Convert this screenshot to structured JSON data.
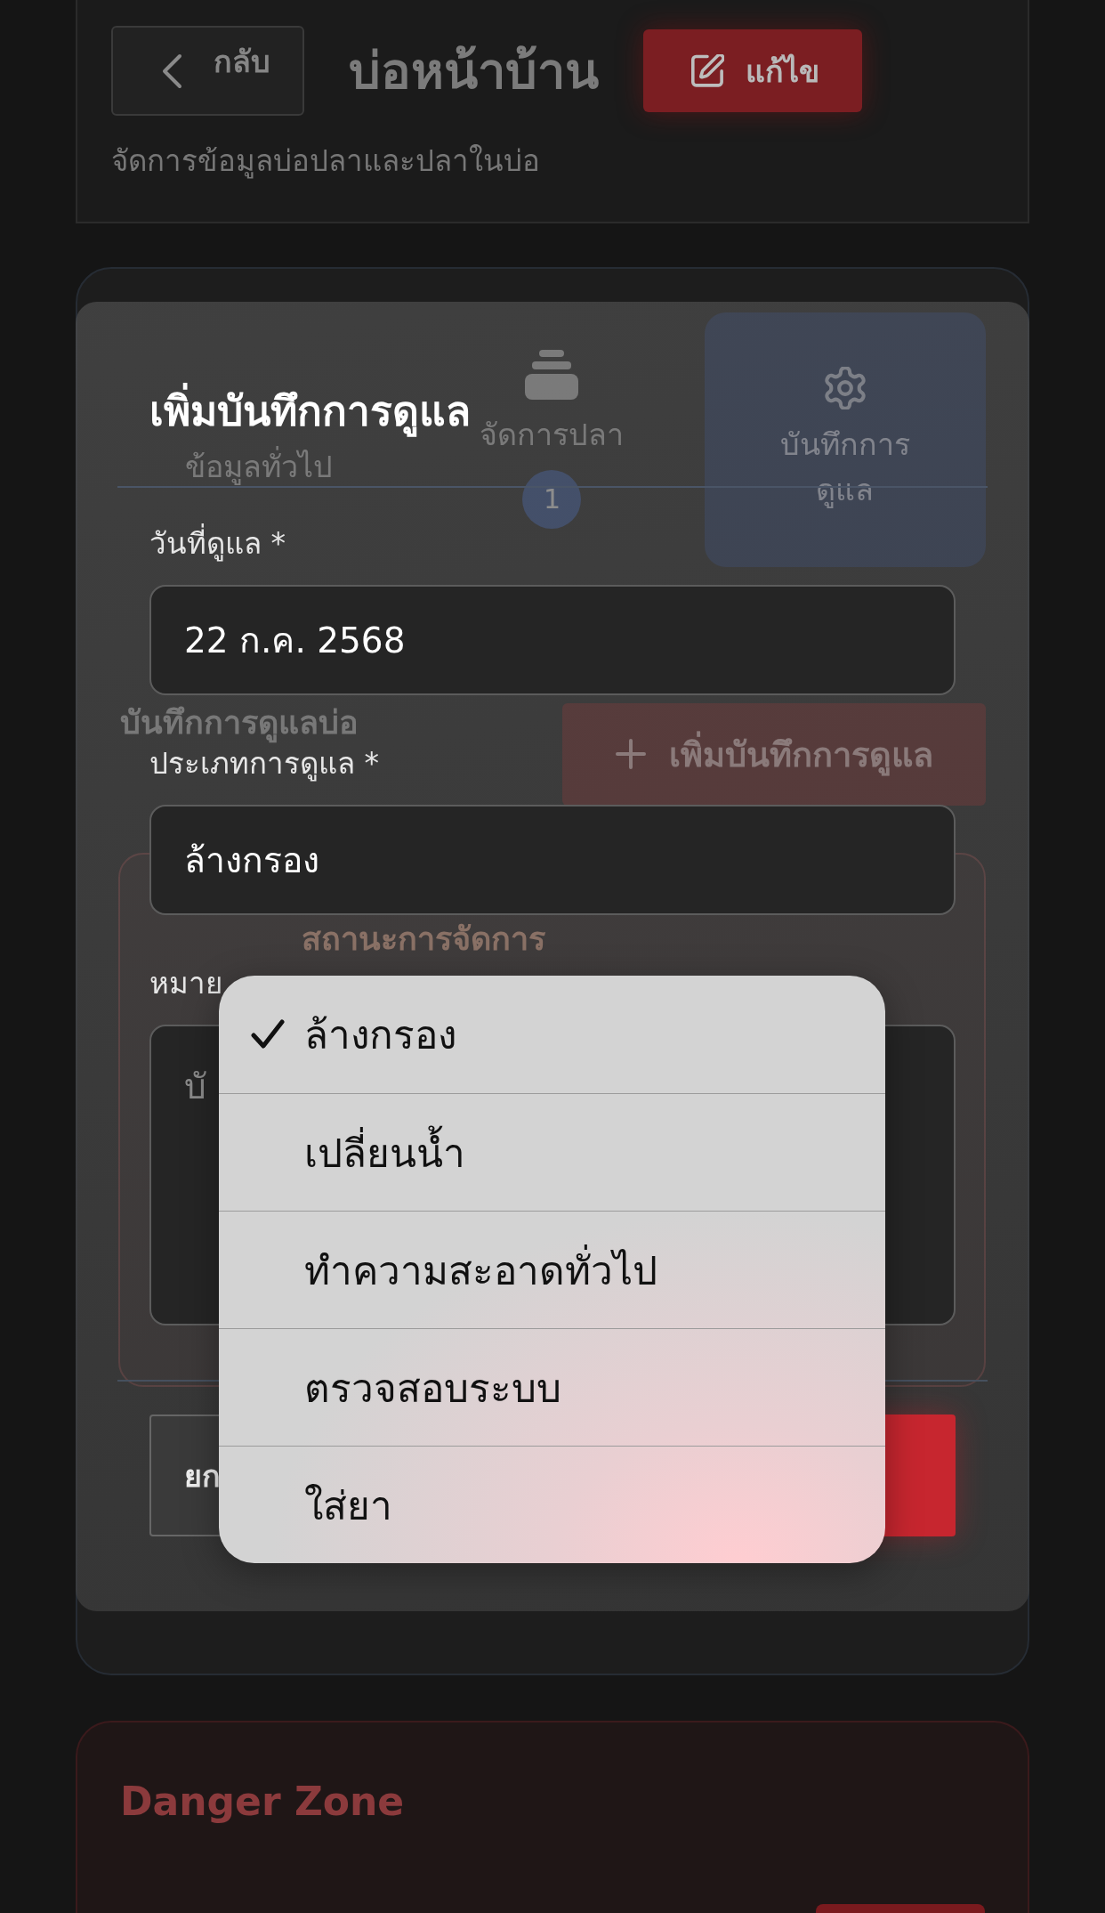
{
  "header": {
    "back_button": {
      "label": "กลับ"
    },
    "title": "บ่อหน้าบ้าน",
    "edit_button": {
      "label": "แก้ไข"
    },
    "subtitle": "จัดการข้อมูลบ่อปลาและปลาในบ่อ"
  },
  "tabs": [
    {
      "label": "ข้อมูลทั่วไป",
      "selected": false
    },
    {
      "label": "จัดการปลา",
      "selected": false,
      "badge": "1"
    },
    {
      "label": "บันทึกการดูแล",
      "selected": true
    }
  ],
  "care_section": {
    "title": "บันทึกการดูแลบ่อ",
    "add_button": {
      "label": "เพิ่มบันทึกการดูแล"
    }
  },
  "status_card": {
    "title": "สถานะการจัดการ"
  },
  "modal": {
    "title": "เพิ่มบันทึกการดูแล",
    "fields": [
      {
        "kind": "date",
        "label": "วันที่ดูแล *",
        "value": "22 ก.ค. 2568"
      },
      {
        "kind": "select",
        "label": "ประเภทการดูแล *",
        "value": "ล้างกรอง"
      },
      {
        "kind": "textarea",
        "label": "หมาย",
        "placeholder": "บั"
      }
    ],
    "buttons": [
      {
        "kind": "secondary",
        "label": "ยก"
      },
      {
        "kind": "primary"
      }
    ]
  },
  "picker": {
    "options": [
      {
        "label": "ล้างกรอง",
        "selected": true
      },
      {
        "label": "เปลี่ยนน้ำ",
        "selected": false
      },
      {
        "label": "ทำความสะอาดทั่วไป",
        "selected": false
      },
      {
        "label": "ตรวจสอบระบบ",
        "selected": false
      },
      {
        "label": "ใส่ยา",
        "selected": false
      }
    ]
  },
  "danger_zone": {
    "title": "Danger Zone"
  }
}
